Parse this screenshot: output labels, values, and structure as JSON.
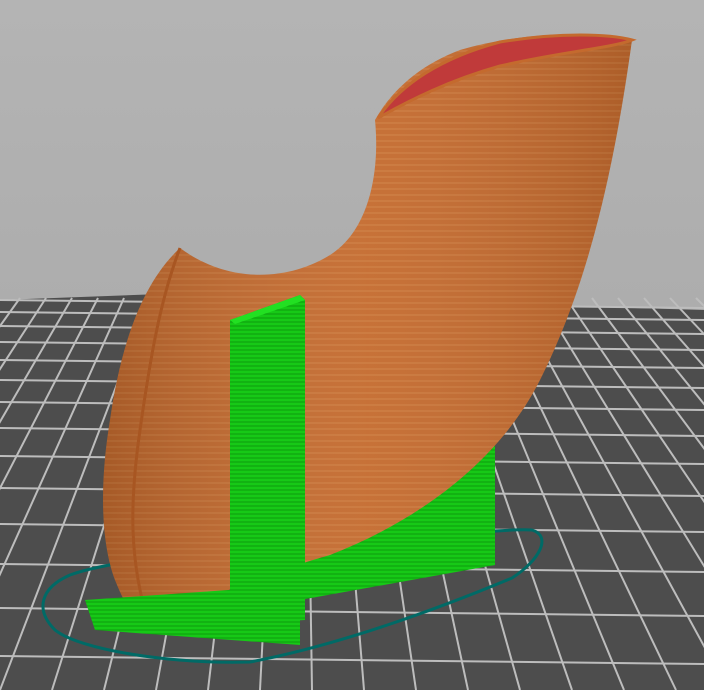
{
  "viewport": {
    "view": "3d-preview",
    "objects": [
      {
        "name": "printed-part",
        "feature": "extrusion-perimeters",
        "color": "#c46a2e"
      },
      {
        "name": "support-material",
        "feature": "support",
        "color": "#19d119"
      },
      {
        "name": "skirt",
        "feature": "skirt-outline",
        "color": "#006a66"
      }
    ],
    "bed": {
      "grid": true,
      "colors": {
        "background": "#4d4d4d",
        "lines": "#bdbdbd"
      }
    },
    "colors": {
      "sky": "#aaaaaa",
      "part_top_edge": "#c03a3a"
    }
  }
}
